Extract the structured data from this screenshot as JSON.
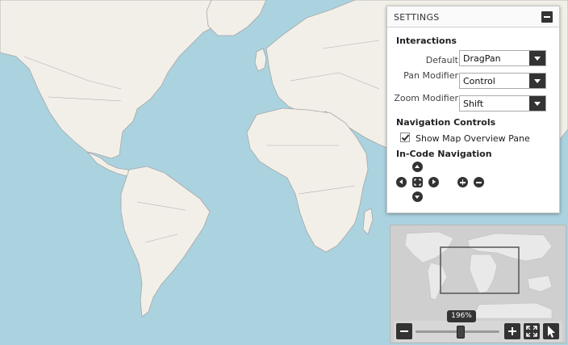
{
  "settings": {
    "title": "SETTINGS",
    "interactions": {
      "heading": "Interactions",
      "default_label": "Default",
      "default_value": "DragPan",
      "pan_label": "Pan Modifier",
      "pan_value": "Control",
      "zoom_label": "Zoom Modifier",
      "zoom_value": "Shift"
    },
    "navigation_controls": {
      "heading": "Navigation Controls",
      "overview_label": "Show Map Overview Pane",
      "overview_checked": true
    },
    "in_code_navigation": {
      "heading": "In-Code Navigation",
      "buttons": [
        "pan-up",
        "pan-down",
        "pan-left",
        "pan-right",
        "center",
        "zoom-in",
        "zoom-out"
      ]
    }
  },
  "overview": {
    "zoom_text": "196%",
    "zoom_level_fraction": 0.5
  },
  "colors": {
    "water": "#aad3df",
    "land": "#f2efe9",
    "border": "#9a9a9a",
    "button_dark": "#333333"
  }
}
